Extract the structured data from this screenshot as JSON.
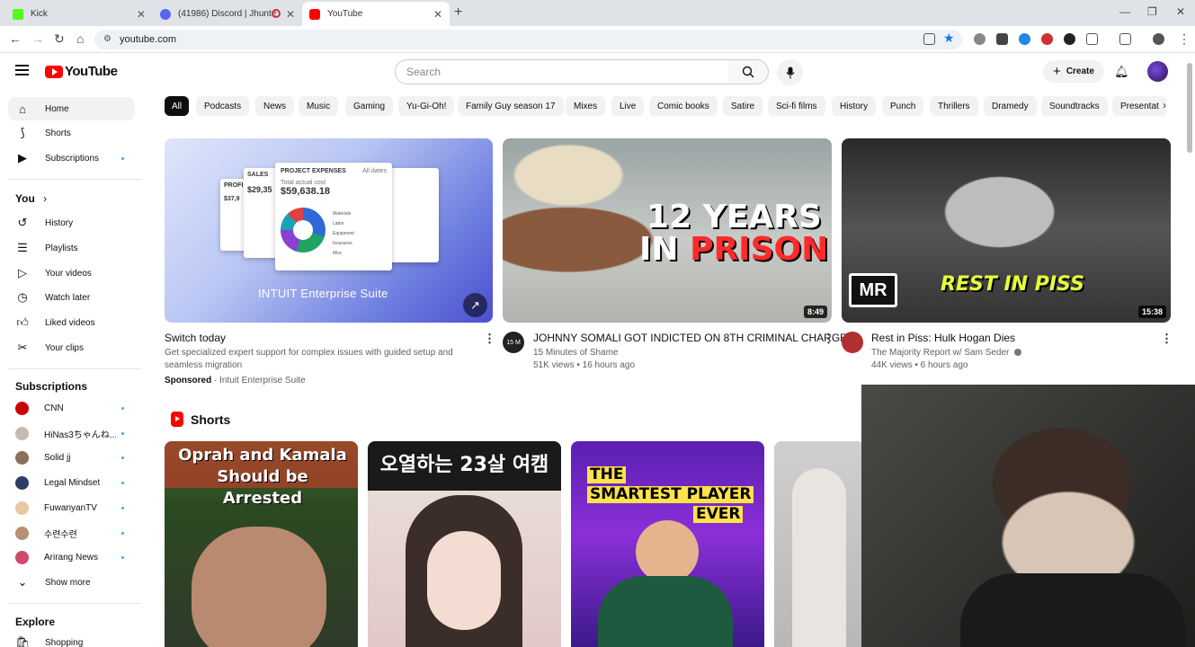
{
  "browser": {
    "tabs": [
      {
        "label": "Kick",
        "fav_color": "#53fc18"
      },
      {
        "label": "(41986) Discord | Jhunter, ...",
        "fav_color": "#5865f2"
      },
      {
        "label": "YouTube",
        "fav_color": "#ff0000"
      }
    ],
    "new_tab": "+",
    "url": "youtube.com"
  },
  "header": {
    "logo_text": "YouTube",
    "search_placeholder": "Search",
    "create_label": "Create"
  },
  "sidebar": {
    "main": [
      {
        "label": "Home",
        "icon": "home-icon"
      },
      {
        "label": "Shorts",
        "icon": "shorts-icon"
      },
      {
        "label": "Subscriptions",
        "icon": "subscriptions-icon"
      }
    ],
    "you_heading": "You",
    "you_items": [
      {
        "label": "History",
        "icon": "history-icon"
      },
      {
        "label": "Playlists",
        "icon": "playlists-icon"
      },
      {
        "label": "Your videos",
        "icon": "your-videos-icon"
      },
      {
        "label": "Watch later",
        "icon": "watch-later-icon"
      },
      {
        "label": "Liked videos",
        "icon": "liked-icon"
      },
      {
        "label": "Your clips",
        "icon": "clips-icon"
      }
    ],
    "subs_heading": "Subscriptions",
    "subs": [
      {
        "label": "CNN",
        "color": "#cc0000"
      },
      {
        "label": "HiNas3ちゃんね...",
        "color": "#c9b8b0"
      },
      {
        "label": "Solid jj",
        "color": "#8a6f5a"
      },
      {
        "label": "Legal Mindset",
        "color": "#2c3e66"
      },
      {
        "label": "FuwanyanTV",
        "color": "#e8c8a0"
      },
      {
        "label": "수련수련",
        "color": "#b89070"
      },
      {
        "label": "Arirang News",
        "color": "#d04a6a"
      }
    ],
    "show_more": "Show more",
    "explore_heading": "Explore",
    "explore_items": [
      {
        "label": "Shopping",
        "icon": "shopping-icon"
      }
    ]
  },
  "chips": [
    "All",
    "Podcasts",
    "News",
    "Music",
    "Gaming",
    "Yu-Gi-Oh!",
    "Family Guy season 17",
    "Mixes",
    "Live",
    "Comic books",
    "Satire",
    "Sci-fi films",
    "History",
    "Punch",
    "Thrillers",
    "Dramedy",
    "Soundtracks",
    "Presentat"
  ],
  "ad": {
    "title": "Switch today",
    "description_1": "Get specialized expert support for complex issues with guided setup and",
    "description_2": "seamless migration",
    "sponsored": "Sponsored",
    "advertiser": "· Intuit Enterprise Suite",
    "thumb_brand": "INTUIT Enterprise Suite",
    "thumb_card_title": "PROJECT EXPENSES",
    "thumb_card_filter": "All dates",
    "thumb_card_sub": "Total actual cost",
    "thumb_card_value": "$59,638.18",
    "thumb_side_title": "SALES",
    "thumb_side_value": "$29,35",
    "thumb_left_title": "PROFI",
    "thumb_left_value": "$37,9",
    "legend": [
      "Materials",
      "Labor",
      "Equipment",
      "Insurance",
      "Misc"
    ]
  },
  "videos": [
    {
      "title": "JOHNNY SOMALI GOT INDICTED ON 8TH CRIMINAL CHARGE",
      "channel": "15 Minutes of Shame",
      "stats": "51K views • 16 hours ago",
      "duration": "8:49",
      "caption_line1": "12 YEARS",
      "caption_line2_a": "IN ",
      "caption_line2_b": "PRISON",
      "channel_avatar_text": "15 M"
    },
    {
      "title": "Rest in Piss: Hulk Hogan Dies",
      "channel": "The Majority Report w/ Sam Seder",
      "stats": "44K views • 6 hours ago",
      "duration": "15:38",
      "caption": "REST IN PISS",
      "badge": "MR"
    }
  ],
  "shorts": {
    "heading": "Shorts",
    "items": [
      {
        "caption": "Oprah and Kamala Should be Arrested"
      },
      {
        "caption": "오열하는 23살 여캠"
      },
      {
        "caption_1": "THE",
        "caption_2": "SMARTEST PLAYER",
        "caption_3": "EVER"
      }
    ]
  }
}
